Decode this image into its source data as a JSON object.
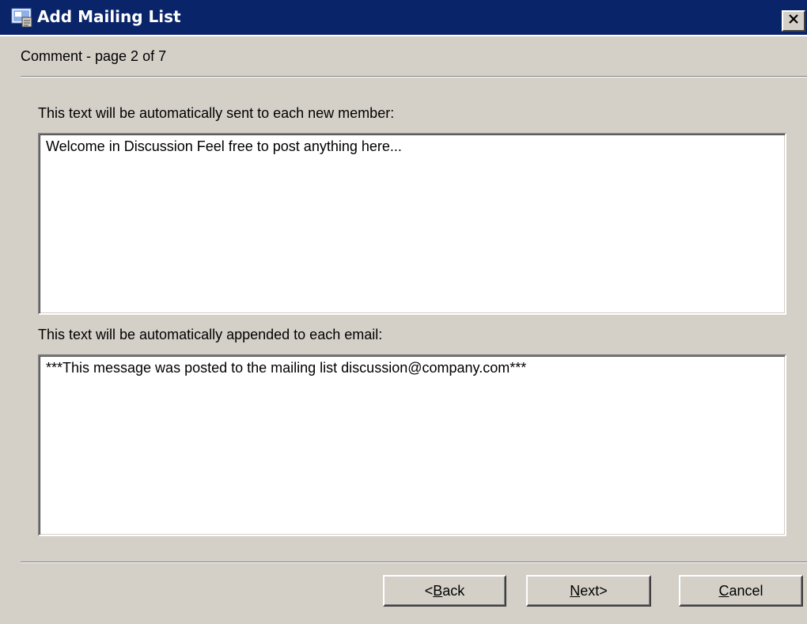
{
  "window": {
    "title": "Add Mailing List",
    "icon": "mailing-list-app-icon",
    "close_icon": "close-icon"
  },
  "wizard": {
    "page_indicator": "Comment - page 2 of 7"
  },
  "welcome": {
    "label": "This text will be automatically sent to each new member:",
    "value": "Welcome in Discussion Feel free to post anything here..."
  },
  "footer_text": {
    "label": "This text will be automatically appended to each email:",
    "value": "***This message was posted to the mailing list discussion@company.com***"
  },
  "buttons": {
    "back": {
      "prefix": "< ",
      "mnemonic": "B",
      "rest": "ack"
    },
    "next": {
      "mnemonic": "N",
      "rest": "ext",
      "suffix": " >"
    },
    "cancel": {
      "mnemonic": "C",
      "rest": "ancel"
    }
  },
  "colors": {
    "titlebar": "#0a246a",
    "dialog_bg": "#d4d0c8",
    "textbox_bg": "#ffffff"
  }
}
